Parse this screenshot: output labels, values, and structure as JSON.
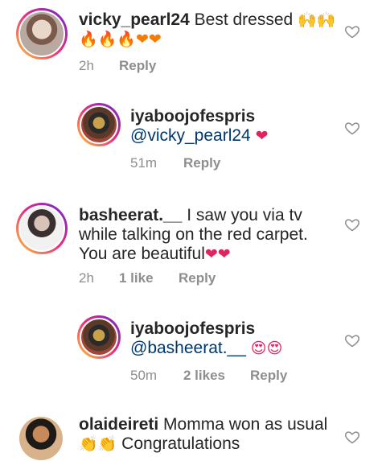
{
  "comments": [
    {
      "username": "vicky_pearl24",
      "text": "Best dressed",
      "emoji_line1": "🙌🙌",
      "emoji_line2": "🔥🔥🔥❤❤",
      "time": "2h",
      "reply": "Reply"
    },
    {
      "username": "iyaboojofespris",
      "mention": "@vicky_pearl24",
      "emoji": "❤",
      "time": "51m",
      "reply": "Reply"
    },
    {
      "username": "basheerat.__",
      "text_line1": "I saw you via tv",
      "text_line2": "while talking on the red carpet.",
      "text_line3": "You are beautiful",
      "emoji": "❤❤",
      "time": "2h",
      "likes": "1 like",
      "reply": "Reply"
    },
    {
      "username": "iyaboojofespris",
      "mention": "@basheerat.__",
      "emoji": "😍😍",
      "time": "50m",
      "likes": "2 likes",
      "reply": "Reply"
    },
    {
      "username": "olaideireti",
      "text_line1": "Momma won as usual",
      "emoji": "👏👏",
      "text_line2": "Congratulations"
    }
  ],
  "icons": {
    "like": "heart-outline-icon"
  },
  "colors": {
    "mention": "#00376b",
    "meta": "#8e8e8e",
    "text": "#262626"
  }
}
